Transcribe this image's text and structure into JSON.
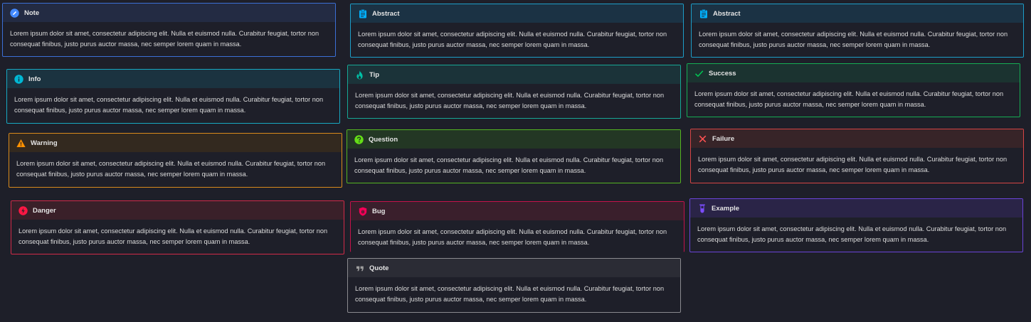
{
  "lorem": {
    "line1": "Lorem ipsum dolor sit amet, consectetur adipiscing elit. Nulla et euismod nulla. Curabitur feugiat, tortor non",
    "line2": "consequat finibus, justo purus auctor massa, nec semper lorem quam in massa."
  },
  "callouts": [
    {
      "id": "note",
      "title": "Note",
      "icon": "pencil-icon",
      "accent": "#448aff"
    },
    {
      "id": "abstract-1",
      "title": "Abstract",
      "icon": "clipboard-icon",
      "accent": "#00b0ff"
    },
    {
      "id": "abstract-2",
      "title": "Abstract",
      "icon": "clipboard-icon",
      "accent": "#00b0ff"
    },
    {
      "id": "info",
      "title": "Info",
      "icon": "info-icon",
      "accent": "#00b8d4"
    },
    {
      "id": "tip",
      "title": "Tip",
      "icon": "flame-icon",
      "accent": "#00bfa5"
    },
    {
      "id": "success",
      "title": "Success",
      "icon": "check-icon",
      "accent": "#00c853"
    },
    {
      "id": "warning",
      "title": "Warning",
      "icon": "warning-icon",
      "accent": "#ff9100"
    },
    {
      "id": "question",
      "title": "Question",
      "icon": "question-icon",
      "accent": "#64dd17"
    },
    {
      "id": "failure",
      "title": "Failure",
      "icon": "x-icon",
      "accent": "#ff5252"
    },
    {
      "id": "danger",
      "title": "Danger",
      "icon": "lightning-icon",
      "accent": "#ff1744"
    },
    {
      "id": "bug",
      "title": "Bug",
      "icon": "bug-shield-icon",
      "accent": "#f50057"
    },
    {
      "id": "example",
      "title": "Example",
      "icon": "test-tube-icon",
      "accent": "#7c4dff"
    },
    {
      "id": "quote",
      "title": "Quote",
      "icon": "quote-marks-icon",
      "accent": "#9e9e9e"
    }
  ]
}
